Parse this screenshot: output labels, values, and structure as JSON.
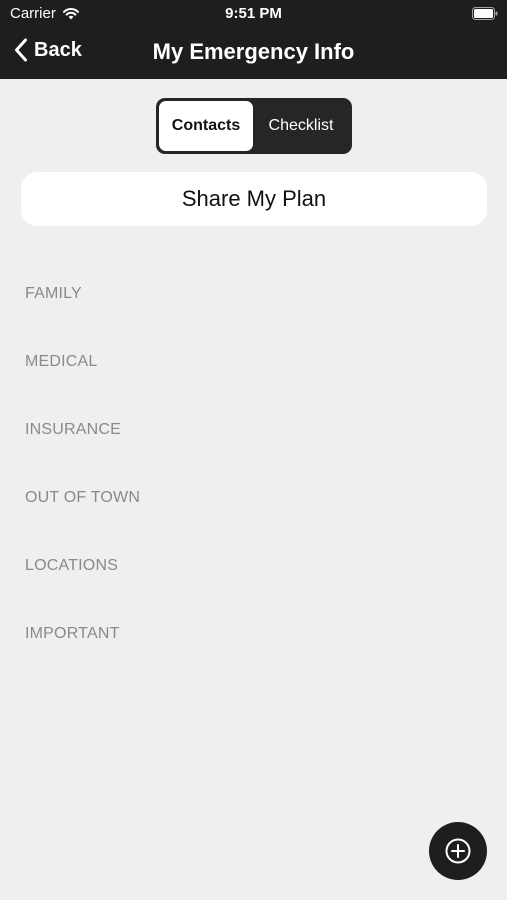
{
  "status_bar": {
    "carrier": "Carrier",
    "time": "9:51 PM",
    "wifi_icon": "wifi-icon",
    "battery_icon": "battery-icon"
  },
  "nav": {
    "back_label": "Back",
    "back_icon": "chevron-left-icon",
    "title": "My Emergency Info"
  },
  "segmented": {
    "tabs": [
      {
        "label": "Contacts",
        "selected": true
      },
      {
        "label": "Checklist",
        "selected": false
      }
    ]
  },
  "share_button": {
    "label": "Share My Plan"
  },
  "sections": [
    "FAMILY",
    "MEDICAL",
    "INSURANCE",
    "OUT OF TOWN",
    "LOCATIONS",
    "IMPORTANT"
  ],
  "fab": {
    "icon": "add-circle-icon"
  },
  "colors": {
    "bar_background": "#1e1e1c",
    "page_background": "#efefef",
    "section_text": "#8a8a8a",
    "white": "#ffffff"
  }
}
